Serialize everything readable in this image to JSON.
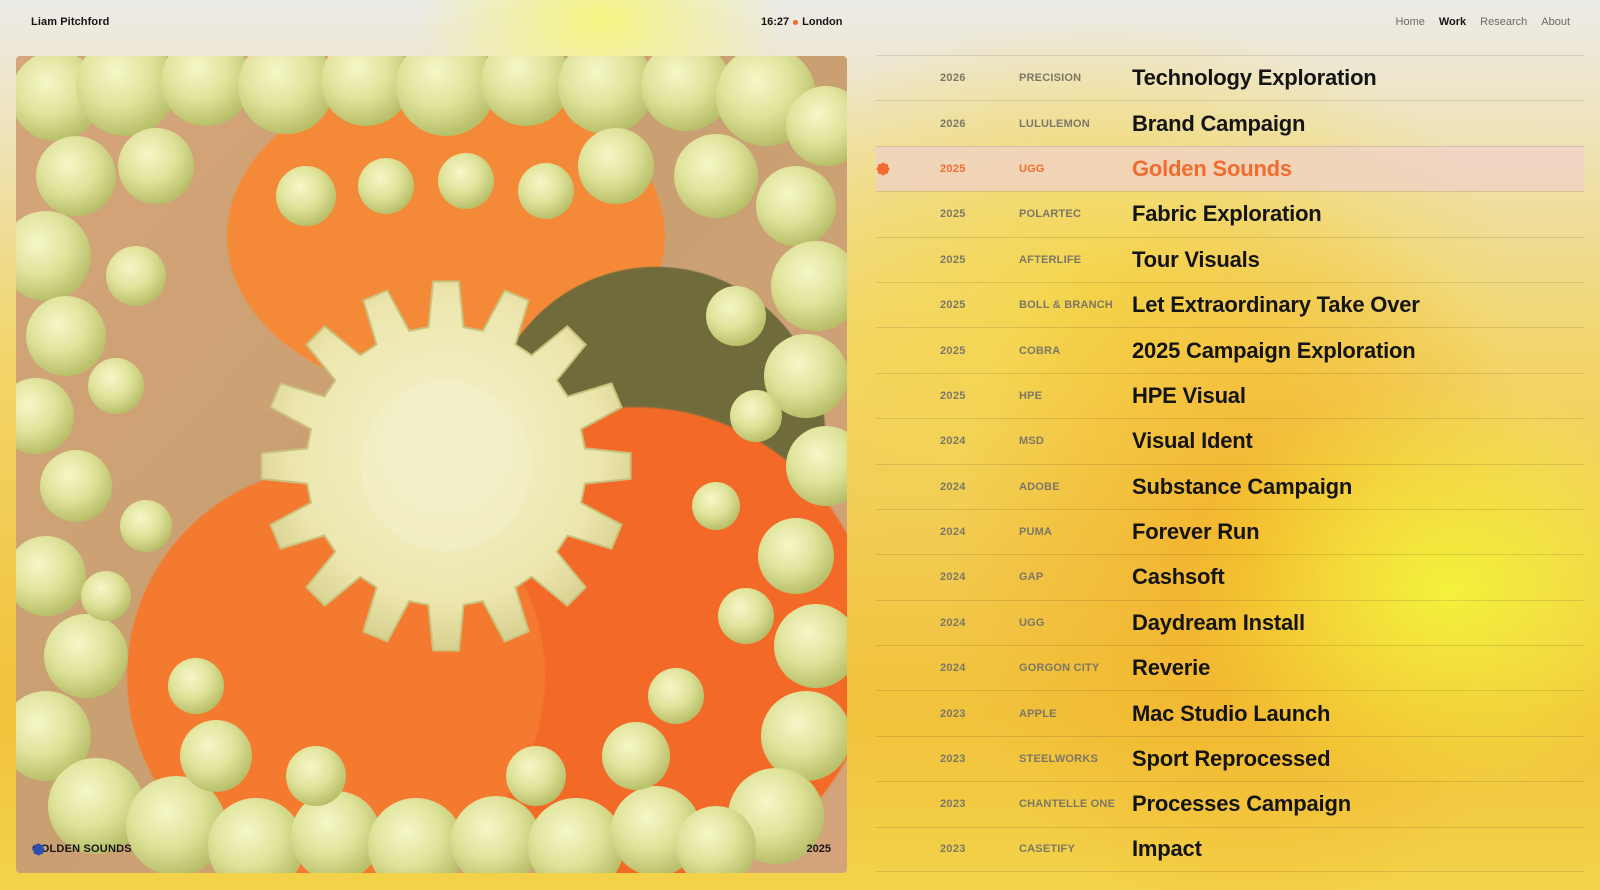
{
  "header": {
    "brand": "Liam Pitchford",
    "time": "16:27",
    "city": "London",
    "nav": [
      {
        "label": "Home",
        "active": false
      },
      {
        "label": "Work",
        "active": true
      },
      {
        "label": "Research",
        "active": false
      },
      {
        "label": "About",
        "active": false
      }
    ]
  },
  "hero": {
    "caption": "GOLDEN SOUNDS",
    "year": "2025",
    "caption_icon": "flower-icon",
    "caption_icon_color": "#2f4fb0"
  },
  "colors": {
    "accent": "#f26b2f",
    "active_row_bg": "#f0d2c8"
  },
  "projects": [
    {
      "year": "2026",
      "client": "PRECISION",
      "title": "Technology Exploration"
    },
    {
      "year": "2026",
      "client": "LULULEMON",
      "title": "Brand Campaign"
    },
    {
      "year": "2025",
      "client": "UGG",
      "title": "Golden Sounds",
      "active": true
    },
    {
      "year": "2025",
      "client": "POLARTEC",
      "title": "Fabric Exploration"
    },
    {
      "year": "2025",
      "client": "AFTERLIFE",
      "title": "Tour Visuals"
    },
    {
      "year": "2025",
      "client": "BOLL & BRANCH",
      "title": "Let Extraordinary Take Over"
    },
    {
      "year": "2025",
      "client": "COBRA",
      "title": "2025 Campaign Exploration"
    },
    {
      "year": "2025",
      "client": "HPE",
      "title": "HPE Visual"
    },
    {
      "year": "2024",
      "client": "MSD",
      "title": "Visual Ident"
    },
    {
      "year": "2024",
      "client": "ADOBE",
      "title": "Substance Campaign"
    },
    {
      "year": "2024",
      "client": "PUMA",
      "title": "Forever Run"
    },
    {
      "year": "2024",
      "client": "GAP",
      "title": "Cashsoft"
    },
    {
      "year": "2024",
      "client": "UGG",
      "title": "Daydream Install"
    },
    {
      "year": "2024",
      "client": "GORGON CITY",
      "title": "Reverie"
    },
    {
      "year": "2023",
      "client": "APPLE",
      "title": "Mac Studio Launch"
    },
    {
      "year": "2023",
      "client": "STEELWORKS",
      "title": "Sport Reprocessed"
    },
    {
      "year": "2023",
      "client": "CHANTELLE ONE",
      "title": "Processes Campaign"
    },
    {
      "year": "2023",
      "client": "CASETIFY",
      "title": "Impact"
    }
  ]
}
